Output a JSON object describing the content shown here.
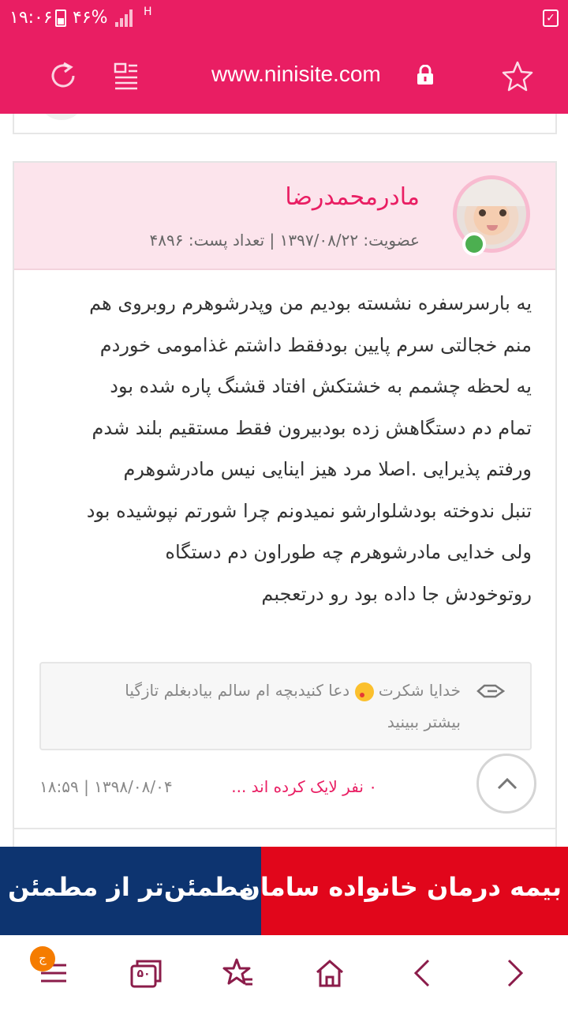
{
  "status_bar": {
    "time": "۱۹:۰۶",
    "battery": "۴۶%",
    "network": "H"
  },
  "browser": {
    "url": "www.ninisite.com"
  },
  "post": {
    "username": "مادرمحمدرضا",
    "meta": "عضویت: ۱۳۹۷/۰۸/۲۲ | تعداد پست: ۴۸۹۶",
    "body_lines": [
      "یه بارسرسفره نشسته بودیم من وپدرشوهرم روبروی هم",
      "منم خجالتی سرم پایین بودفقط داشتم غذامومی خوردم",
      "یه لحظه چشمم به خشتکش افتاد قشنگ پاره شده بود",
      "تمام دم دستگاهش زده بودبیرون فقط مستقیم بلند شدم",
      "ورفتم پذیرایی .اصلا مرد هیز اینایی نیس مادرشوهرم",
      "تنبل ندوخته بودشلوارشو نمیدونم چرا شورتم نپوشیده بود",
      "ولی خدایی مادرشوهرم چه طوراون دم دستگاه",
      "روتوخودش جا داده بود رو درتعجبم"
    ],
    "quote_line1_before": "خدایا شکرت",
    "quote_line1_after": "دعا کنیدبچه ام سالم بیادبغلم تازگیا",
    "quote_more": "بیشتر ببینید",
    "likes": "۰ نفر لایک کرده اند ...",
    "date": "۱۸:۵۹ | ۱۳۹۸/۰۸/۰۴"
  },
  "ad": {
    "left_text": "مطمئن‌تر از مطمئن",
    "right_text": "بیمه درمان خانواده سامان"
  },
  "bottom_nav": {
    "menu_badge": "ج",
    "tabs_count": "۵۰"
  },
  "colors": {
    "brand": "#e91e63",
    "ad_blue": "#0d3470",
    "ad_red": "#e1061b",
    "nav_icon": "#8b1c4a"
  }
}
